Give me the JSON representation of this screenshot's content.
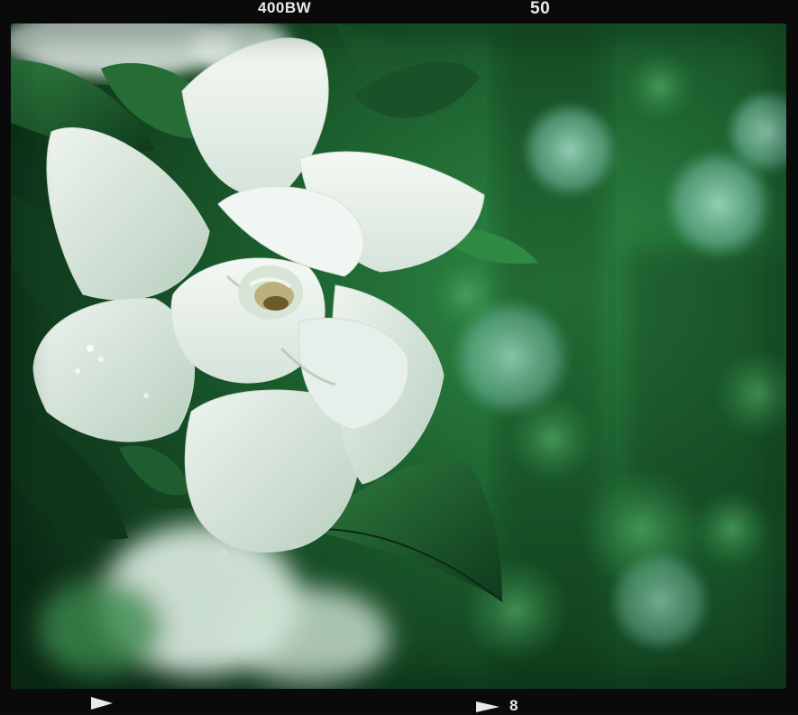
{
  "film_edge": {
    "film_type": "400BW",
    "frame_number_top": "50",
    "frame_number_bottom": "8"
  },
  "photo": {
    "colors": {
      "petal": "#eef3ee",
      "petal_shadow": "#b9cfc0",
      "leaf_dark": "#0f3a1c",
      "leaf_mid": "#2c7a3c",
      "bokeh": "#9fd7c2",
      "stamen": "#6b5a2a"
    }
  }
}
